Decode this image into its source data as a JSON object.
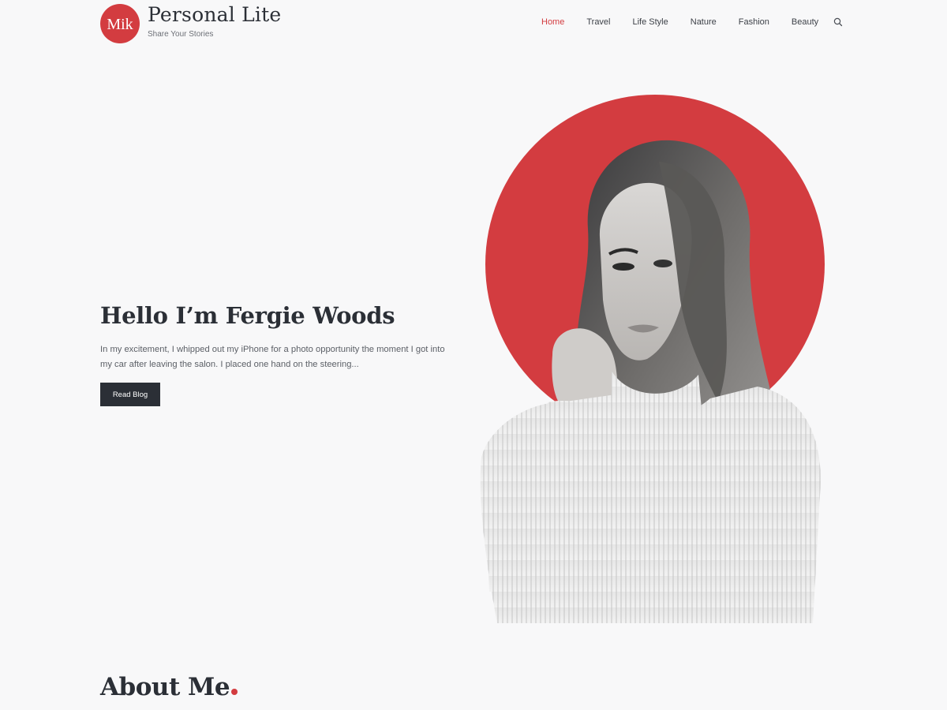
{
  "brand": {
    "logo_text": "Mik",
    "title": "Personal Lite",
    "tagline": "Share Your Stories",
    "accent_color": "#d33c40",
    "dark_color": "#2b2f36"
  },
  "nav": {
    "items": [
      {
        "label": "Home",
        "active": true
      },
      {
        "label": "Travel",
        "active": false
      },
      {
        "label": "Life Style",
        "active": false
      },
      {
        "label": "Nature",
        "active": false
      },
      {
        "label": "Fashion",
        "active": false
      },
      {
        "label": "Beauty",
        "active": false
      }
    ],
    "search_icon": "search-icon"
  },
  "hero": {
    "heading": "Hello I’m Fergie Woods",
    "excerpt": "In my excitement, I whipped out my iPhone for a photo opportunity the moment I got into my car after leaving the salon. I placed one hand on the steering...",
    "button_label": "Read Blog",
    "image": "portrait-photo"
  },
  "about": {
    "heading": "About Me"
  }
}
